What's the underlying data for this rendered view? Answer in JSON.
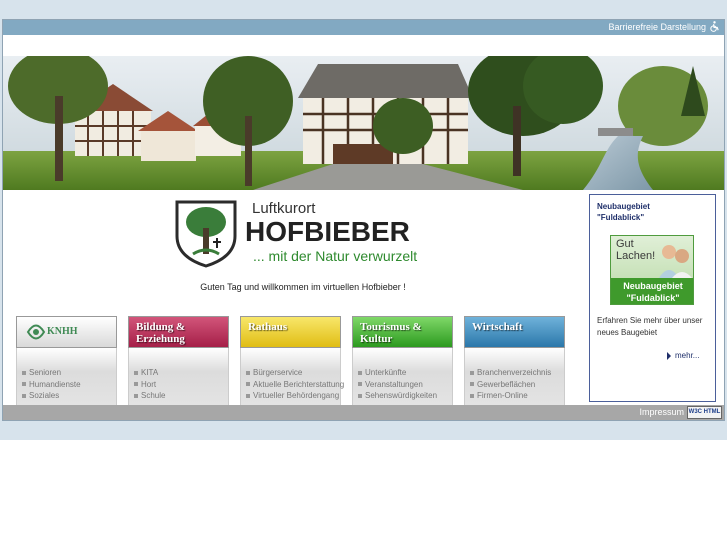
{
  "header": {
    "accessibility_label": "Barrierefreie Darstellung"
  },
  "logo": {
    "tagline_top": "Luftkurort",
    "name": "HOFBIEBER",
    "tagline_bottom": "... mit der Natur verwurzelt"
  },
  "welcome_text": "Guten Tag und willkommen im virtuellen Hofbieber !",
  "categories": [
    {
      "title": "KNHH",
      "items": [
        "Senioren",
        "Humandienste",
        "Soziales"
      ]
    },
    {
      "title": "Bildung & Erziehung",
      "items": [
        "KITA",
        "Hort",
        "Schule"
      ]
    },
    {
      "title": "Rathaus",
      "items": [
        "Bürgerservice",
        "Aktuelle Berichterstattung",
        "Virtueller Behördengang"
      ]
    },
    {
      "title": "Tourismus & Kultur",
      "items": [
        "Unterkünfte",
        "Veranstaltungen",
        "Sehenswürdigkeiten"
      ]
    },
    {
      "title": "Wirtschaft",
      "items": [
        "Branchenverzeichnis",
        "Gewerbeflächen",
        "Firmen-Online"
      ]
    }
  ],
  "sidebox": {
    "title_line1": "Neubaugebiet",
    "title_line2": "\"Fuldablick\"",
    "ad_line1": "Gut",
    "ad_line2": "Lachen!",
    "ad_band1": "Neubaugebiet",
    "ad_band2": "\"Fuldablick\"",
    "description": "Erfahren Sie mehr über unser neues Baugebiet",
    "more_label": "mehr..."
  },
  "footer": {
    "impressum": "Impressum",
    "w3c": "W3C HTML 4.01"
  },
  "colors": {
    "topbar": "#82a9c2",
    "bildung": "#a51f48",
    "rathaus": "#e0bd14",
    "tourismus": "#2c9a1f",
    "wirtschaft": "#2b77aa",
    "sidebox_border": "#4b5f9a"
  }
}
